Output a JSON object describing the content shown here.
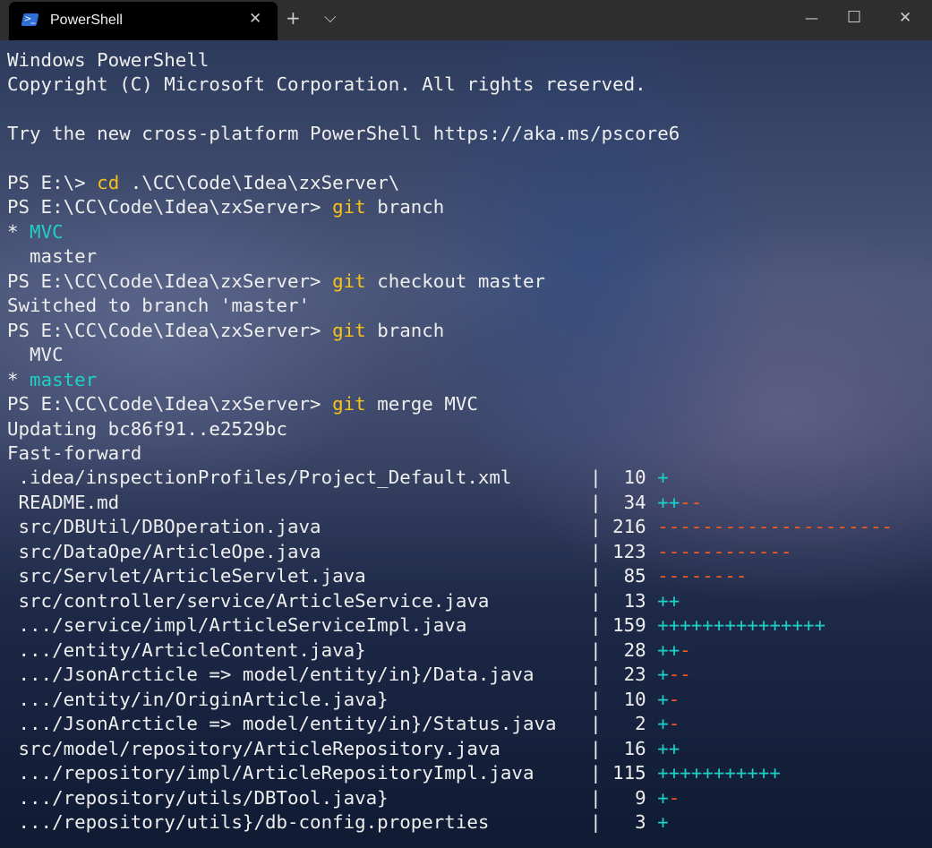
{
  "window": {
    "tab_title": "PowerShell",
    "tab_icon": "powershell-icon",
    "icon_glyph": ">_",
    "close_tab": "✕",
    "new_tab": "+",
    "dropdown": "⌵",
    "minimize": "—",
    "maximize": "☐",
    "close": "✕"
  },
  "colors": {
    "yellow": "#f7c21a",
    "cyan": "#1fd0c6",
    "orange": "#ff5a1e",
    "text": "#eeeeee"
  },
  "terminal": {
    "lines": [
      [
        {
          "t": "Windows PowerShell"
        }
      ],
      [
        {
          "t": "Copyright (C) Microsoft Corporation. All rights reserved."
        }
      ],
      [
        {
          "t": ""
        }
      ],
      [
        {
          "t": "Try the new cross-platform PowerShell https://aka.ms/pscore6"
        }
      ],
      [
        {
          "t": ""
        }
      ],
      [
        {
          "t": "PS E:\\> "
        },
        {
          "t": "cd",
          "c": "yellow"
        },
        {
          "t": " .\\CC\\Code\\Idea\\zxServer\\"
        }
      ],
      [
        {
          "t": "PS E:\\CC\\Code\\Idea\\zxServer> "
        },
        {
          "t": "git",
          "c": "yellow"
        },
        {
          "t": " branch"
        }
      ],
      [
        {
          "t": "* "
        },
        {
          "t": "MVC",
          "c": "cyan"
        }
      ],
      [
        {
          "t": "  master"
        }
      ],
      [
        {
          "t": "PS E:\\CC\\Code\\Idea\\zxServer> "
        },
        {
          "t": "git",
          "c": "yellow"
        },
        {
          "t": " checkout master"
        }
      ],
      [
        {
          "t": "Switched to branch 'master'"
        }
      ],
      [
        {
          "t": "PS E:\\CC\\Code\\Idea\\zxServer> "
        },
        {
          "t": "git",
          "c": "yellow"
        },
        {
          "t": " branch"
        }
      ],
      [
        {
          "t": "  MVC"
        }
      ],
      [
        {
          "t": "* "
        },
        {
          "t": "master",
          "c": "cyan"
        }
      ],
      [
        {
          "t": "PS E:\\CC\\Code\\Idea\\zxServer> "
        },
        {
          "t": "git",
          "c": "yellow"
        },
        {
          "t": " merge MVC"
        }
      ],
      [
        {
          "t": "Updating bc86f91..e2529bc"
        }
      ],
      [
        {
          "t": "Fast-forward"
        }
      ],
      [
        {
          "t": " .idea/inspectionProfiles/Project_Default.xml       |  10 "
        },
        {
          "t": "+",
          "c": "cyan"
        }
      ],
      [
        {
          "t": " README.md                                          |  34 "
        },
        {
          "t": "++",
          "c": "cyan"
        },
        {
          "t": "--",
          "c": "orange"
        }
      ],
      [
        {
          "t": " src/DBUtil/DBOperation.java                        | 216 "
        },
        {
          "t": "---------------------",
          "c": "orange"
        }
      ],
      [
        {
          "t": " src/DataOpe/ArticleOpe.java                        | 123 "
        },
        {
          "t": "------------",
          "c": "orange"
        }
      ],
      [
        {
          "t": " src/Servlet/ArticleServlet.java                    |  85 "
        },
        {
          "t": "--------",
          "c": "orange"
        }
      ],
      [
        {
          "t": " src/controller/service/ArticleService.java         |  13 "
        },
        {
          "t": "++",
          "c": "cyan"
        }
      ],
      [
        {
          "t": " .../service/impl/ArticleServiceImpl.java           | 159 "
        },
        {
          "t": "+++++++++++++++",
          "c": "cyan"
        }
      ],
      [
        {
          "t": " .../entity/ArticleContent.java}                    |  28 "
        },
        {
          "t": "++",
          "c": "cyan"
        },
        {
          "t": "-",
          "c": "orange"
        }
      ],
      [
        {
          "t": " .../JsonArcticle => model/entity/in}/Data.java     |  23 "
        },
        {
          "t": "+",
          "c": "cyan"
        },
        {
          "t": "--",
          "c": "orange"
        }
      ],
      [
        {
          "t": " .../entity/in/OriginArticle.java}                  |  10 "
        },
        {
          "t": "+",
          "c": "cyan"
        },
        {
          "t": "-",
          "c": "orange"
        }
      ],
      [
        {
          "t": " .../JsonArcticle => model/entity/in}/Status.java   |   2 "
        },
        {
          "t": "+",
          "c": "cyan"
        },
        {
          "t": "-",
          "c": "orange"
        }
      ],
      [
        {
          "t": " src/model/repository/ArticleRepository.java        |  16 "
        },
        {
          "t": "++",
          "c": "cyan"
        }
      ],
      [
        {
          "t": " .../repository/impl/ArticleRepositoryImpl.java     | 115 "
        },
        {
          "t": "+++++++++++",
          "c": "cyan"
        }
      ],
      [
        {
          "t": " .../repository/utils/DBTool.java}                  |   9 "
        },
        {
          "t": "+",
          "c": "cyan"
        },
        {
          "t": "-",
          "c": "orange"
        }
      ],
      [
        {
          "t": " .../repository/utils}/db-config.properties         |   3 "
        },
        {
          "t": "+",
          "c": "cyan"
        }
      ]
    ]
  }
}
